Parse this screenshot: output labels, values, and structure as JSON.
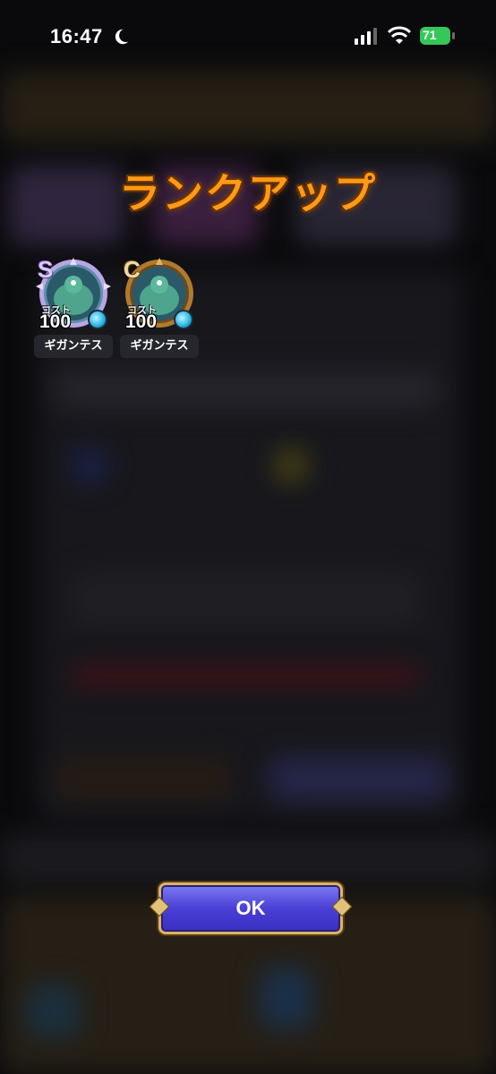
{
  "status_bar": {
    "time": "16:47",
    "battery": "71",
    "icons": [
      "moon-icon",
      "signal-icon",
      "wifi-icon",
      "battery-charging-icon"
    ]
  },
  "dialog": {
    "title": "ランクアップ",
    "ok_label": "OK"
  },
  "monsters": [
    {
      "rank": "S",
      "cost_label": "コスト",
      "cost": "100",
      "name": "ギガンテス",
      "rank_color": "#d9c9ff"
    },
    {
      "rank": "C",
      "cost_label": "コスト",
      "cost": "100",
      "name": "ギガンテス",
      "rank_color": "#f1d9a8"
    }
  ],
  "colors": {
    "title": "#ff9a17",
    "ok_button": "#4a3fd6",
    "battery": "#35c759"
  }
}
